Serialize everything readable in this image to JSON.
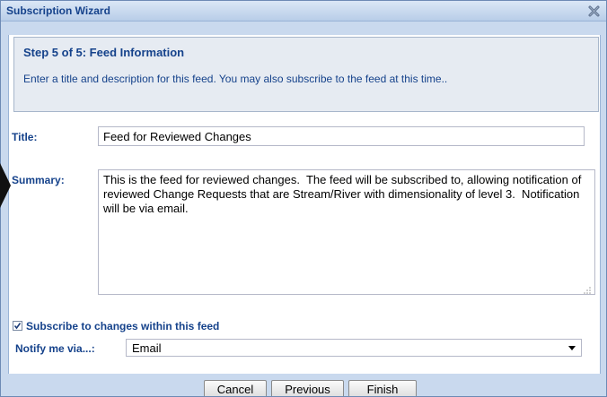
{
  "window": {
    "title": "Subscription Wizard",
    "close_icon": "close-x-icon"
  },
  "step": {
    "heading": "Step 5 of 5: Feed Information",
    "description": "Enter a title and description for this feed. You may also subscribe to the feed at this time.."
  },
  "form": {
    "title_label": "Title:",
    "title_value": "Feed for Reviewed Changes",
    "summary_label": "Summary:",
    "summary_value": "This is the feed for reviewed changes.  The feed will be subscribed to, allowing notification of reviewed Change Requests that are Stream/River with dimensionality of level 3.  Notification will be via email.",
    "subscribe_label": "Subscribe to changes within this feed",
    "subscribe_checked": true,
    "notify_label": "Notify me via...:",
    "notify_value": "Email"
  },
  "buttons": {
    "cancel": "Cancel",
    "previous": "Previous",
    "finish": "Finish"
  },
  "colors": {
    "label_blue": "#15428b",
    "frame_blue": "#c9d9ee"
  }
}
